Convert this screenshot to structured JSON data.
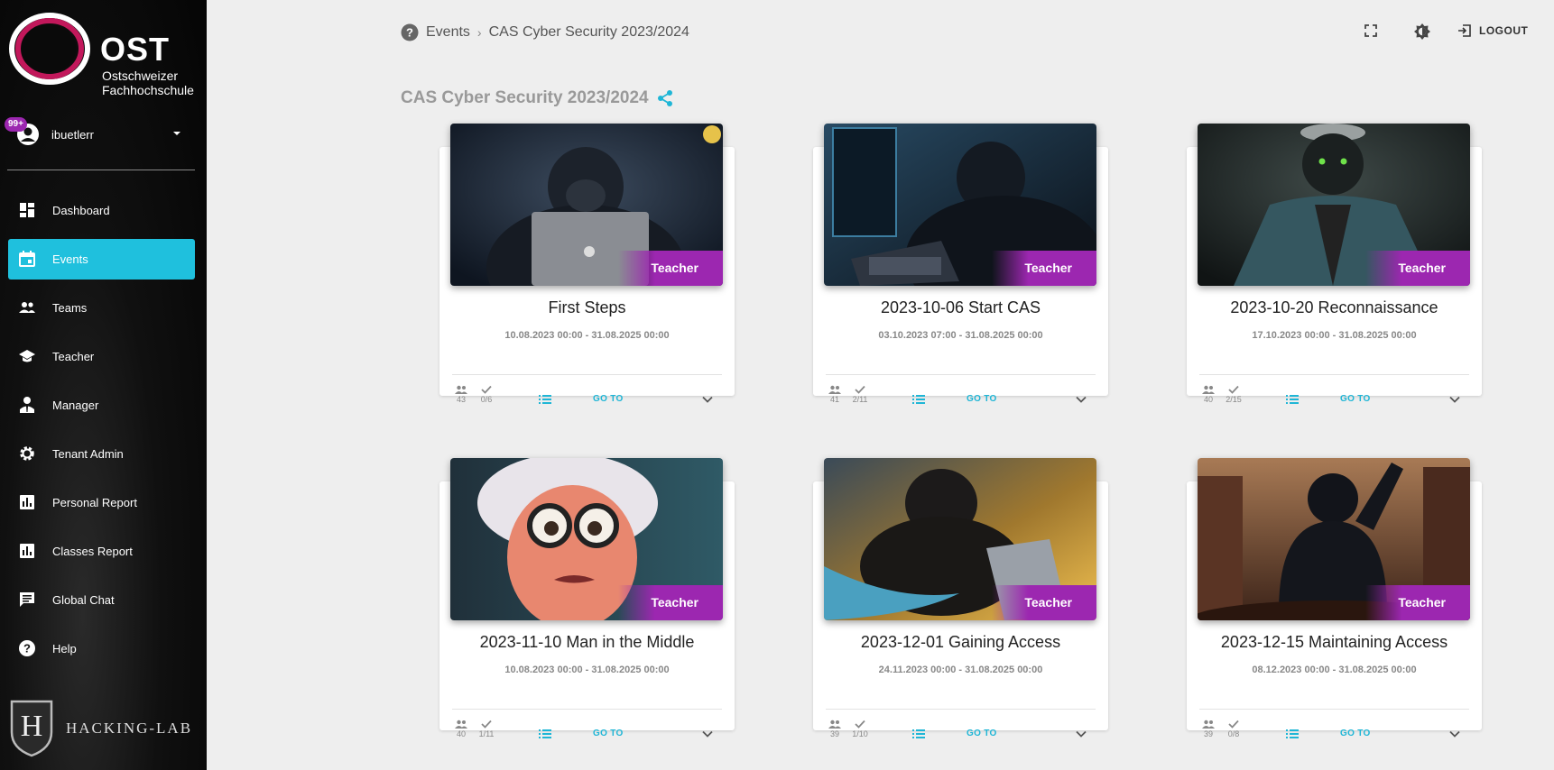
{
  "brand": {
    "name": "OST",
    "line1": "Ostschweizer",
    "line2": "Fachhochschule",
    "footer_logo": "HACKING-LAB"
  },
  "user": {
    "name": "ibuetlerr",
    "badge": "99+"
  },
  "nav": [
    {
      "label": "Dashboard",
      "icon": "dashboard-icon",
      "active": false
    },
    {
      "label": "Events",
      "icon": "calendar-icon",
      "active": true
    },
    {
      "label": "Teams",
      "icon": "people-icon",
      "active": false
    },
    {
      "label": "Teacher",
      "icon": "school-icon",
      "active": false
    },
    {
      "label": "Manager",
      "icon": "manager-icon",
      "active": false
    },
    {
      "label": "Tenant Admin",
      "icon": "gear-icon",
      "active": false
    },
    {
      "label": "Personal Report",
      "icon": "bar-chart-icon",
      "active": false
    },
    {
      "label": "Classes Report",
      "icon": "bar-chart-icon",
      "active": false
    },
    {
      "label": "Global Chat",
      "icon": "chat-icon",
      "active": false
    },
    {
      "label": "Help",
      "icon": "help-icon",
      "active": false
    }
  ],
  "breadcrumb": {
    "root": "Events",
    "current": "CAS Cyber Security 2023/2024"
  },
  "topbar": {
    "logout_label": "LOGOUT"
  },
  "page": {
    "title": "CAS Cyber Security 2023/2024"
  },
  "colors": {
    "accent": "#1fc0dd",
    "role_tag": "#9c27b0"
  },
  "cards": [
    {
      "title": "First Steps",
      "dates": "10.08.2023 00:00 - 31.08.2025 00:00",
      "role": "Teacher",
      "members": "43",
      "solved": "0/6",
      "goto": "GO TO",
      "image": "gorilla-laptop"
    },
    {
      "title": "2023-10-06 Start CAS",
      "dates": "03.10.2023 07:00 - 31.08.2025 00:00",
      "role": "Teacher",
      "members": "41",
      "solved": "2/11",
      "goto": "GO TO",
      "image": "gorilla-hacker-keyboard"
    },
    {
      "title": "2023-10-20 Reconnaissance",
      "dates": "17.10.2023 00:00 - 31.08.2025 00:00",
      "role": "Teacher",
      "members": "40",
      "solved": "2/15",
      "goto": "GO TO",
      "image": "gorilla-suit"
    },
    {
      "title": "2023-11-10 Man in the Middle",
      "dates": "10.08.2023 00:00 - 31.08.2025 00:00",
      "role": "Teacher",
      "members": "40",
      "solved": "1/11",
      "goto": "GO TO",
      "image": "grandma-glasses"
    },
    {
      "title": "2023-12-01 Gaining Access",
      "dates": "24.11.2023 00:00 - 31.08.2025 00:00",
      "role": "Teacher",
      "members": "39",
      "solved": "1/10",
      "goto": "GO TO",
      "image": "gorilla-wave"
    },
    {
      "title": "2023-12-15 Maintaining Access",
      "dates": "08.12.2023 00:00 - 31.08.2025 00:00",
      "role": "Teacher",
      "members": "39",
      "solved": "0/8",
      "goto": "GO TO",
      "image": "gorilla-crowd"
    }
  ]
}
